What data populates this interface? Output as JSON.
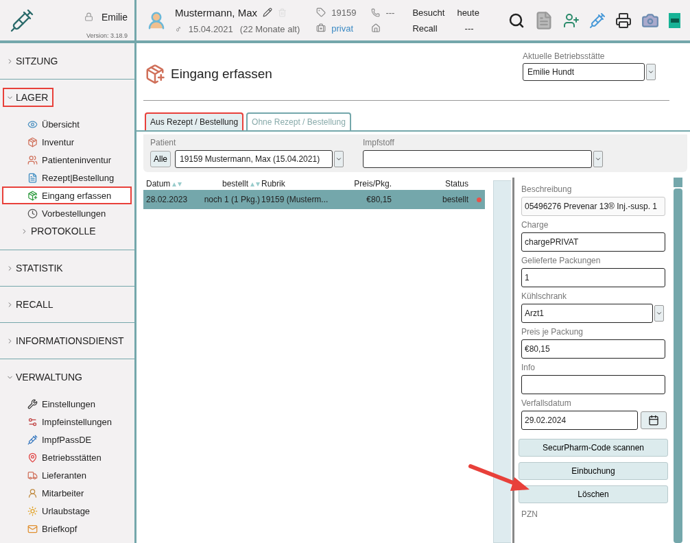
{
  "sidebar": {
    "user": "Emilie",
    "version": "Version: 3.18.9",
    "sections": [
      {
        "label": "SITZUNG",
        "expanded": false,
        "highlighted": false
      },
      {
        "label": "LAGER",
        "expanded": true,
        "highlighted": true,
        "items": [
          {
            "label": "Übersicht",
            "kind": "link",
            "selected": false,
            "highlighted": false
          },
          {
            "label": "Inventur",
            "kind": "link",
            "selected": false,
            "highlighted": false
          },
          {
            "label": "Patienteninventur",
            "kind": "link",
            "selected": false,
            "highlighted": false
          },
          {
            "label": "Rezept|Bestellung",
            "kind": "link",
            "selected": false,
            "highlighted": false
          },
          {
            "label": "Eingang erfassen",
            "kind": "link",
            "selected": true,
            "highlighted": true
          },
          {
            "label": "Vorbestellungen",
            "kind": "link",
            "selected": false,
            "highlighted": false
          },
          {
            "label": "PROTOKOLLE",
            "kind": "group",
            "expanded": false
          }
        ]
      },
      {
        "label": "STATISTIK",
        "expanded": false,
        "highlighted": false
      },
      {
        "label": "RECALL",
        "expanded": false,
        "highlighted": false
      },
      {
        "label": "INFORMATIONSDIENST",
        "expanded": false,
        "highlighted": false
      },
      {
        "label": "VERWALTUNG",
        "expanded": true,
        "highlighted": false,
        "items": [
          {
            "label": "Einstellungen",
            "kind": "link",
            "selected": false,
            "highlighted": false
          },
          {
            "label": "Impfeinstellungen",
            "kind": "link",
            "selected": false,
            "highlighted": false
          },
          {
            "label": "ImpfPassDE",
            "kind": "link",
            "selected": false,
            "highlighted": false
          },
          {
            "label": "Betriebsstätten",
            "kind": "link",
            "selected": false,
            "highlighted": false
          },
          {
            "label": "Lieferanten",
            "kind": "link",
            "selected": false,
            "highlighted": false
          },
          {
            "label": "Mitarbeiter",
            "kind": "link",
            "selected": false,
            "highlighted": false
          },
          {
            "label": "Urlaubstage",
            "kind": "link",
            "selected": false,
            "highlighted": false
          },
          {
            "label": "Briefkopf",
            "kind": "link",
            "selected": false,
            "highlighted": false
          }
        ]
      }
    ]
  },
  "patient": {
    "name": "Mustermann, Max",
    "gender": "♂",
    "birthdate": "15.04.2021",
    "age": "(22 Monate alt)",
    "number": "19159",
    "phone": "---",
    "insurance": "privat",
    "visited_label": "Besucht",
    "visited": "heute",
    "recall_label": "Recall",
    "recall": "---"
  },
  "page": {
    "title": "Eingang erfassen",
    "location_label": "Aktuelle Betriebsstätte",
    "location": "Emilie Hundt"
  },
  "tabs": [
    {
      "label": "Aus Rezept / Bestellung",
      "selected": true,
      "highlighted": true
    },
    {
      "label": "Ohne Rezept / Bestellung",
      "selected": false,
      "highlighted": false
    }
  ],
  "filter": {
    "patient_label": "Patient",
    "all_button": "Alle",
    "patient": "19159 Mustermann, Max (15.04.2021)",
    "vaccine_label": "Impfstoff"
  },
  "table": {
    "columns": [
      {
        "label": "Datum",
        "sortable": true
      },
      {
        "label": "bestellt",
        "sortable": true
      },
      {
        "label": "Rubrik",
        "sortable": false
      },
      {
        "label": "Preis/Pkg.",
        "sortable": false
      },
      {
        "label": "Status",
        "sortable": false
      }
    ],
    "rows": [
      {
        "cells": [
          "28.02.2023",
          "noch 1 (1 Pkg.)",
          "19159 (Musterm...",
          "€80,15",
          "bestellt"
        ],
        "color": "#e8524a",
        "selected": true
      }
    ]
  },
  "form": {
    "fields": [
      {
        "label": "Beschreibung",
        "kind": "text",
        "value": "05496276 Prevenar 13® Inj.-susp. 1",
        "readonly": true
      },
      {
        "label": "Charge",
        "kind": "text",
        "value": "chargePRIVAT",
        "readonly": false
      },
      {
        "label": "Gelieferte Packungen",
        "kind": "text",
        "value": "1",
        "readonly": false
      },
      {
        "label": "Kühlschrank",
        "kind": "select",
        "value": "Arzt1",
        "readonly": false
      },
      {
        "label": "Preis je Packung",
        "kind": "text",
        "value": "€80,15",
        "readonly": false
      },
      {
        "label": "Info",
        "kind": "text",
        "readonly": false
      },
      {
        "label": "Verfallsdatum",
        "kind": "date",
        "value": "29.02.2024",
        "readonly": false
      }
    ],
    "buttons": [
      "SecurPharm-Code scannen",
      "Einbuchung",
      "Löschen"
    ],
    "next_label": "PZN"
  },
  "annotation_arrow": true
}
